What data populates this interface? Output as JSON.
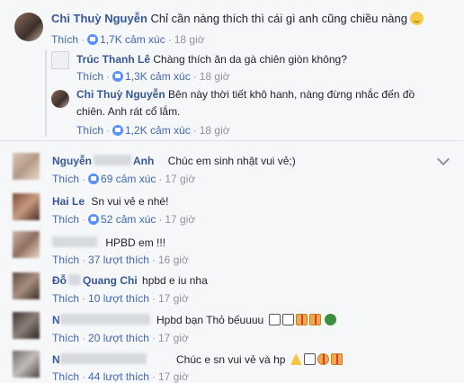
{
  "thread": {
    "main": {
      "author": "Chi Thuỳ Nguyễn",
      "text": "Chỉ cần nàng thích thì cái gì anh cũng chiều nàng",
      "like_label": "Thích",
      "reactions": "1,7K cảm xúc",
      "time": "18 giờ"
    },
    "replies": [
      {
        "author": "Trúc Thanh Lê",
        "text": "Chàng thích ăn da gà chiên giòn không?",
        "like_label": "Thích",
        "reactions": "1,3K cảm xúc",
        "time": "18 giờ"
      },
      {
        "author": "Chi Thuỳ Nguyễn",
        "text_line1": "Bên này thời tiết khô hanh, nàng đừng nhắc đến đồ",
        "text_line2": "chiên. Anh rát cổ lắm.",
        "like_label": "Thích",
        "reactions": "1,2K cảm xúc",
        "time": "18 giờ"
      }
    ]
  },
  "comments": [
    {
      "name_partial": "Nguyễn",
      "name_tail": "Anh",
      "text": "Chúc em sinh nhật vui vẻ;)",
      "like_label": "Thích",
      "reactions": "69 cảm xúc",
      "time": "17 giờ"
    },
    {
      "name_partial": "Hai Le",
      "name_tail": "",
      "text": "Sn vui vẻ e nhé!",
      "like_label": "Thích",
      "reactions": "52 cảm xúc",
      "time": "17 giờ"
    },
    {
      "name_partial": "",
      "name_tail": "",
      "text": "HPBD em !!!",
      "like_label": "Thích",
      "reactions": "37 lượt thích",
      "time": "16 giờ"
    },
    {
      "name_partial": "Đỗ",
      "name_tail": "Quang Chi",
      "text": "hpbd e iu nha",
      "like_label": "Thích",
      "reactions": "10 lượt thích",
      "time": "17 giờ"
    },
    {
      "name_partial": "N",
      "name_tail": "",
      "text": "Hpbd bạn Thỏ bếuuuu",
      "like_label": "Thích",
      "reactions": "20 lượt thích",
      "time": "17 giờ"
    },
    {
      "name_partial": "N",
      "name_tail": "",
      "text": "Chúc e sn vui vẻ và hp",
      "like_label": "Thích",
      "reactions": "44 lượt thích",
      "time": "17 giờ"
    }
  ],
  "icons": {
    "emoji_smile": "smiling-face-icon",
    "like_reaction": "like-reaction-icon",
    "chevron": "chevron-down-icon",
    "stickers": [
      "cake-icon",
      "gift-icon",
      "tree-icon",
      "party-popper-icon"
    ]
  },
  "colors": {
    "link": "#365899",
    "action": "#4267b2",
    "meta": "#90949c",
    "background": "#f6f7f9"
  }
}
